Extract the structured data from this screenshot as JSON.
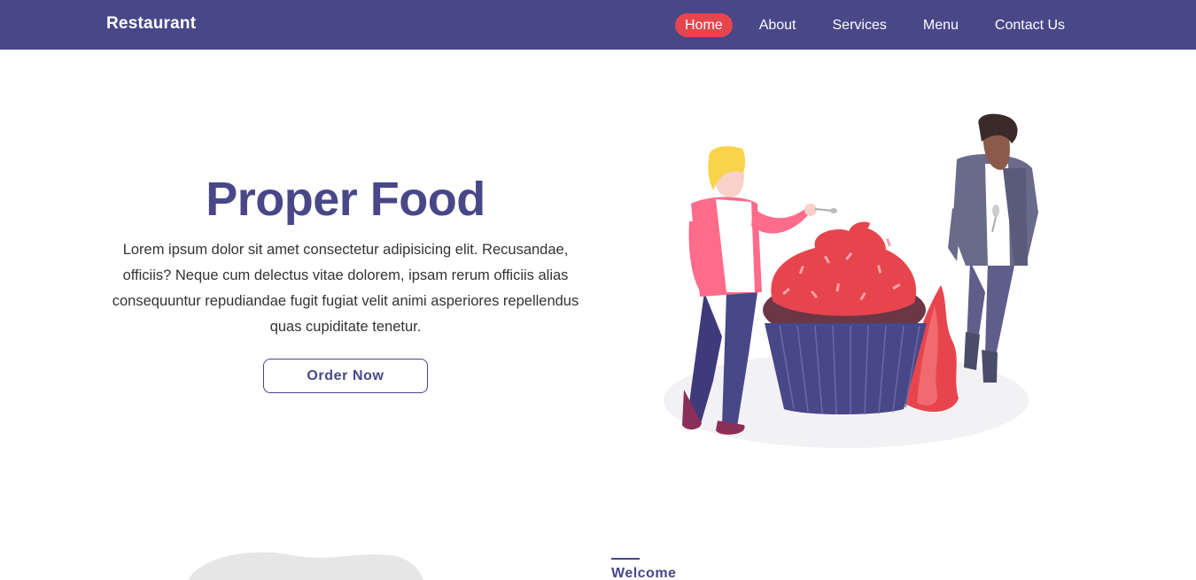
{
  "brand": "Restaurant",
  "nav": [
    {
      "label": "Home",
      "active": true
    },
    {
      "label": "About",
      "active": false
    },
    {
      "label": "Services",
      "active": false
    },
    {
      "label": "Menu",
      "active": false
    },
    {
      "label": "Contact Us",
      "active": false
    }
  ],
  "hero": {
    "title": "Proper Food",
    "description": "Lorem ipsum dolor sit amet consectetur adipisicing elit. Recusandae, officiis? Neque cum delectus vitae dolorem, ipsam rerum officiis alias consequuntur repudiandae fugit fugiat velit animi asperiores repellendus quas cupiditate tenetur.",
    "button_label": "Order Now"
  },
  "about": {
    "welcome_label": "Welcome"
  },
  "colors": {
    "primary": "#484788",
    "accent": "#e7454d",
    "text": "#333333"
  }
}
